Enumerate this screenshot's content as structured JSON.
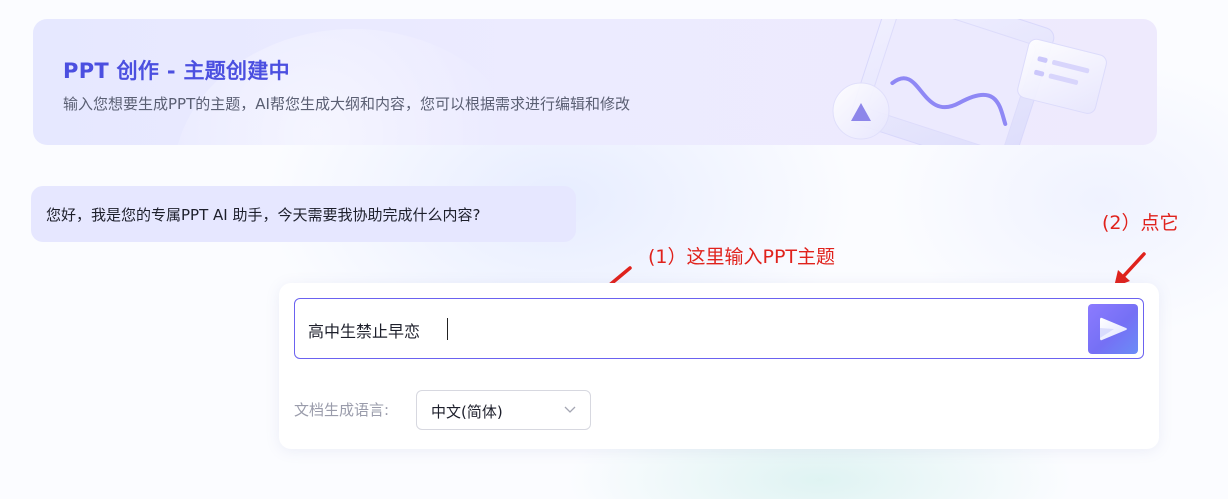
{
  "banner": {
    "title": "PPT 创作 - 主题创建中",
    "subtitle": "输入您想要生成PPT的主题，AI帮您生成大纲和内容，您可以根据需求进行编辑和修改"
  },
  "chat": {
    "greeting": "您好，我是您的专属PPT AI 助手，今天需要我协助完成什么内容?"
  },
  "topic_input": {
    "value": "高中生禁止早恋"
  },
  "language": {
    "label": "文档生成语言:",
    "selected": "中文(简体)"
  },
  "annotations": {
    "step1": "(1）这里输入PPT主题",
    "step2": "(2）点它"
  },
  "colors": {
    "accent": "#4b4fe0",
    "annotation": "#e0221c",
    "bubble": "#e6e7ff",
    "input_border": "#6b62f0"
  },
  "icons": {
    "send": "send-icon",
    "dropdown": "chevron-down-icon"
  }
}
